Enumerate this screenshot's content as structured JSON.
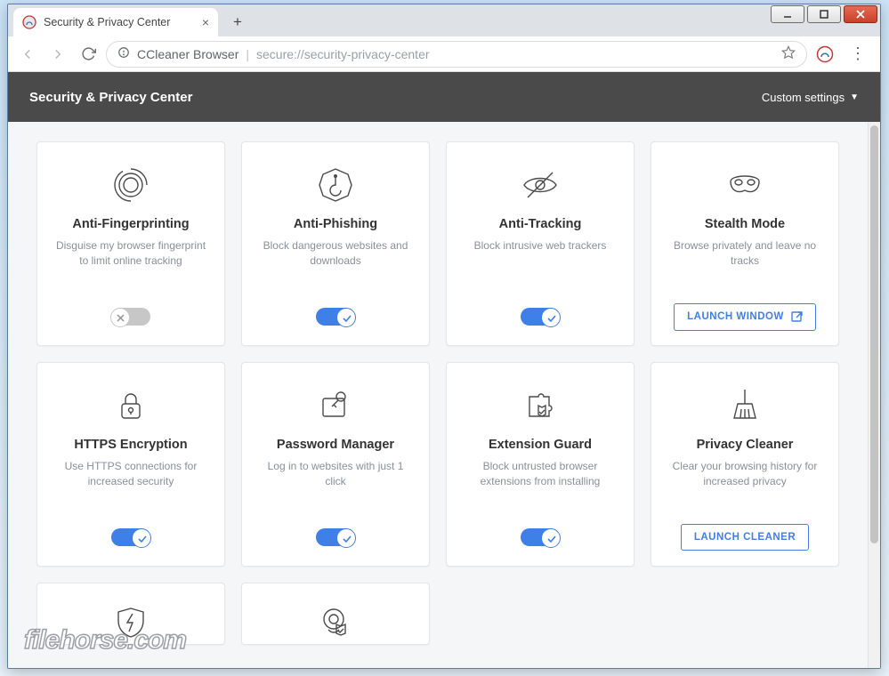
{
  "window": {
    "tab_title": "Security & Privacy Center",
    "browser_brand": "CCleaner Browser",
    "url": "secure://security-privacy-center"
  },
  "header": {
    "title": "Security & Privacy Center",
    "settings_label": "Custom settings"
  },
  "cards": [
    {
      "icon": "fingerprint-icon",
      "title": "Anti-Fingerprinting",
      "desc": "Disguise my browser fingerprint to limit online tracking",
      "action": "toggle",
      "on": false
    },
    {
      "icon": "phishing-icon",
      "title": "Anti-Phishing",
      "desc": "Block dangerous websites and downloads",
      "action": "toggle",
      "on": true
    },
    {
      "icon": "eye-slash-icon",
      "title": "Anti-Tracking",
      "desc": "Block intrusive web trackers",
      "action": "toggle",
      "on": true
    },
    {
      "icon": "mask-icon",
      "title": "Stealth Mode",
      "desc": "Browse privately and leave no tracks",
      "action": "button",
      "label": "LAUNCH WINDOW",
      "ext_icon": true
    },
    {
      "icon": "lock-icon",
      "title": "HTTPS Encryption",
      "desc": "Use HTTPS connections for increased security",
      "action": "toggle",
      "on": true
    },
    {
      "icon": "key-icon",
      "title": "Password Manager",
      "desc": "Log in to websites with just 1 click",
      "action": "toggle",
      "on": true
    },
    {
      "icon": "puzzle-shield-icon",
      "title": "Extension Guard",
      "desc": "Block untrusted browser extensions from installing",
      "action": "toggle",
      "on": true
    },
    {
      "icon": "broom-icon",
      "title": "Privacy Cleaner",
      "desc": "Clear your browsing history for increased privacy",
      "action": "button",
      "label": "LAUNCH CLEANER",
      "ext_icon": false
    }
  ],
  "partial_cards": [
    {
      "icon": "flash-shield-icon"
    },
    {
      "icon": "webcam-shield-icon"
    }
  ],
  "watermark": "filehorse.com"
}
